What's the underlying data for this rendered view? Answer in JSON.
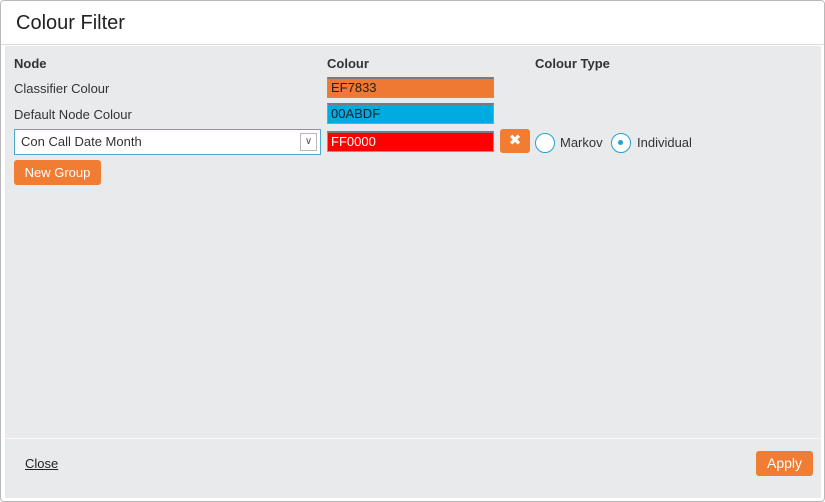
{
  "dialog": {
    "title": "Colour Filter"
  },
  "columns": {
    "node": "Node",
    "colour": "Colour",
    "colour_type": "Colour Type"
  },
  "rows": [
    {
      "label": "Classifier Colour",
      "hex": "EF7833",
      "color": "#EF7833"
    },
    {
      "label": "Default Node Colour",
      "hex": "00ABDF",
      "color": "#00ABDF"
    }
  ],
  "group": {
    "selected": "Con Call Date Month",
    "hex": "FF0000",
    "color": "#FF0000",
    "delete_icon": "✖",
    "radios": [
      {
        "label": "Markov",
        "checked": false
      },
      {
        "label": "Individual",
        "checked": true
      }
    ]
  },
  "buttons": {
    "new_group": "New Group",
    "close": "Close",
    "apply": "Apply"
  },
  "colors": {
    "accent": "#F07D33",
    "radio": "#22A2D0"
  }
}
